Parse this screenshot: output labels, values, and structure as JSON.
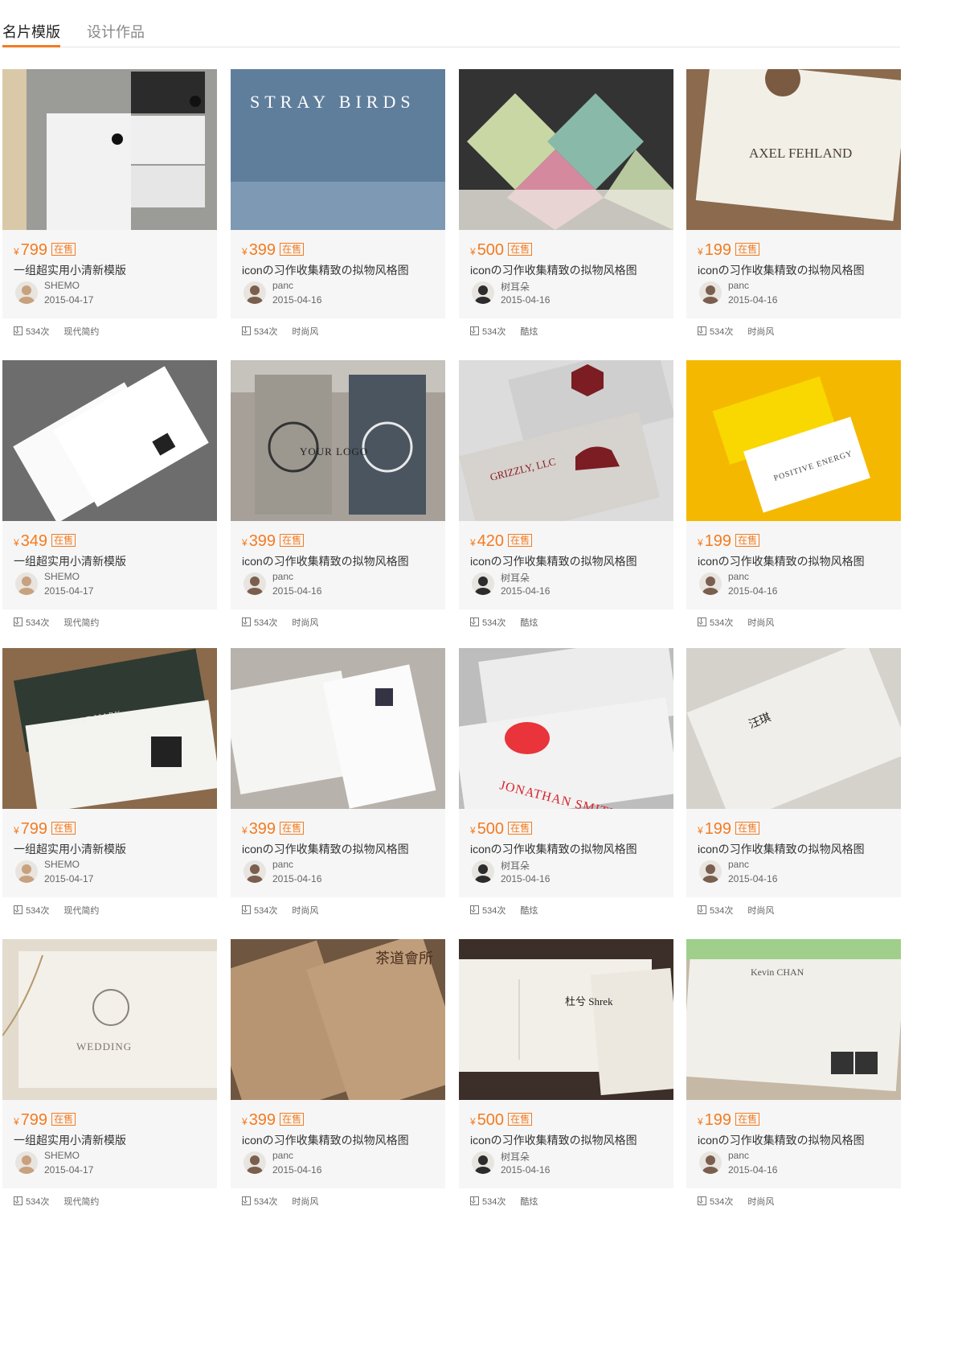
{
  "tabs": {
    "active": "名片模版",
    "inactive": "设计作品"
  },
  "accent_color": "#f47b20",
  "currency": "¥",
  "status_badge": "在售",
  "cards": [
    {
      "price": "799",
      "title": "一组超实用小清新模版",
      "author": "SHEMO",
      "date": "2015-04-17",
      "downloads": "534次",
      "tag": "现代简约",
      "thumb_text": ""
    },
    {
      "price": "399",
      "title": "iconの习作收集精致の拟物风格图",
      "author": "panc",
      "date": "2015-04-16",
      "downloads": "534次",
      "tag": "时尚风",
      "thumb_text": "STRAY BIRDS"
    },
    {
      "price": "500",
      "title": "iconの习作收集精致の拟物风格图",
      "author": "树耳朵",
      "date": "2015-04-16",
      "downloads": "534次",
      "tag": "酷炫",
      "thumb_text": ""
    },
    {
      "price": "199",
      "title": "iconの习作收集精致の拟物风格图",
      "author": "panc",
      "date": "2015-04-16",
      "downloads": "534次",
      "tag": "时尚风",
      "thumb_text": "AXEL FEHLAND"
    },
    {
      "price": "349",
      "title": "一组超实用小清新模版",
      "author": "SHEMO",
      "date": "2015-04-17",
      "downloads": "534次",
      "tag": "现代简约",
      "thumb_text": ""
    },
    {
      "price": "399",
      "title": "iconの习作收集精致の拟物风格图",
      "author": "panc",
      "date": "2015-04-16",
      "downloads": "534次",
      "tag": "时尚风",
      "thumb_text": "YOUR LOGO"
    },
    {
      "price": "420",
      "title": "iconの习作收集精致の拟物风格图",
      "author": "树耳朵",
      "date": "2015-04-16",
      "downloads": "534次",
      "tag": "酷炫",
      "thumb_text": "GRIZZLY, LLC"
    },
    {
      "price": "199",
      "title": "iconの习作收集精致の拟物风格图",
      "author": "panc",
      "date": "2015-04-16",
      "downloads": "534次",
      "tag": "时尚风",
      "thumb_text": "POSITIVE ENERGY"
    },
    {
      "price": "799",
      "title": "一组超实用小清新模版",
      "author": "SHEMO",
      "date": "2015-04-17",
      "downloads": "534次",
      "tag": "现代简约",
      "thumb_text": "STEWART MARK"
    },
    {
      "price": "399",
      "title": "iconの习作收集精致の拟物风格图",
      "author": "panc",
      "date": "2015-04-16",
      "downloads": "534次",
      "tag": "时尚风",
      "thumb_text": ""
    },
    {
      "price": "500",
      "title": "iconの习作收集精致の拟物风格图",
      "author": "树耳朵",
      "date": "2015-04-16",
      "downloads": "534次",
      "tag": "酷炫",
      "thumb_text": "JONATHAN SMITH"
    },
    {
      "price": "199",
      "title": "iconの习作收集精致の拟物风格图",
      "author": "panc",
      "date": "2015-04-16",
      "downloads": "534次",
      "tag": "时尚风",
      "thumb_text": "汪琪"
    },
    {
      "price": "799",
      "title": "一组超实用小清新模版",
      "author": "SHEMO",
      "date": "2015-04-17",
      "downloads": "534次",
      "tag": "现代简约",
      "thumb_text": "WEDDING"
    },
    {
      "price": "399",
      "title": "iconの习作收集精致の拟物风格图",
      "author": "panc",
      "date": "2015-04-16",
      "downloads": "534次",
      "tag": "时尚风",
      "thumb_text": "茶道會所"
    },
    {
      "price": "500",
      "title": "iconの习作收集精致の拟物风格图",
      "author": "树耳朵",
      "date": "2015-04-16",
      "downloads": "534次",
      "tag": "酷炫",
      "thumb_text": "杜兮 Shrek"
    },
    {
      "price": "199",
      "title": "iconの习作收集精致の拟物风格图",
      "author": "panc",
      "date": "2015-04-16",
      "downloads": "534次",
      "tag": "时尚风",
      "thumb_text": "Kevin CHAN"
    }
  ]
}
